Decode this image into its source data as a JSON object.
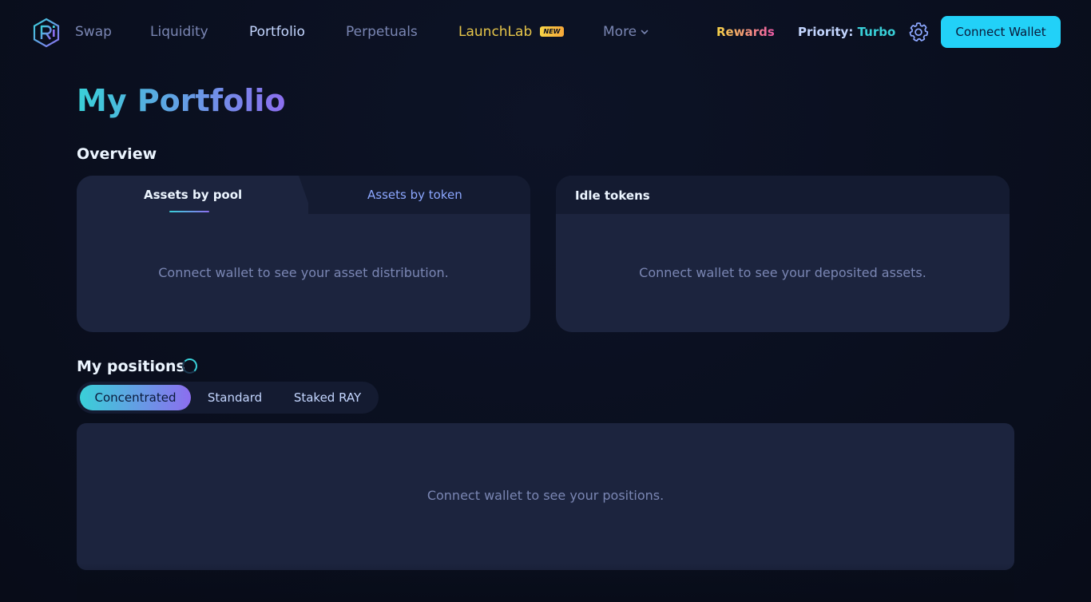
{
  "nav": {
    "links": [
      "Swap",
      "Liquidity",
      "Portfolio",
      "Perpetuals",
      "LaunchLab",
      "More"
    ],
    "launchlab_badge": "NEW",
    "rewards": "Rewards",
    "priority_label": "Priority:",
    "priority_value": "Turbo",
    "connect_label": "Connect Wallet"
  },
  "page": {
    "title": "My Portfolio",
    "overview_title": "Overview",
    "positions_title": "My positions"
  },
  "assets_card": {
    "tabs": [
      "Assets by pool",
      "Assets by token"
    ],
    "active_tab": "Assets by pool",
    "empty": "Connect wallet to see your asset distribution."
  },
  "idle_card": {
    "title": "Idle tokens",
    "empty": "Connect wallet to see your deposited assets."
  },
  "positions": {
    "tabs": [
      "Concentrated",
      "Standard",
      "Staked RAY"
    ],
    "active_tab": "Concentrated",
    "empty": "Connect wallet to see your positions."
  },
  "colors": {
    "background": "#0a0f1f",
    "card": "#1c243e",
    "accent_cyan": "#39d0d8",
    "accent_purple": "#8c6eef",
    "connect_button": "#22d1f8"
  },
  "icons": [
    "raydium-logo-icon",
    "chevron-down-icon",
    "gear-icon",
    "loading-spinner-icon"
  ]
}
